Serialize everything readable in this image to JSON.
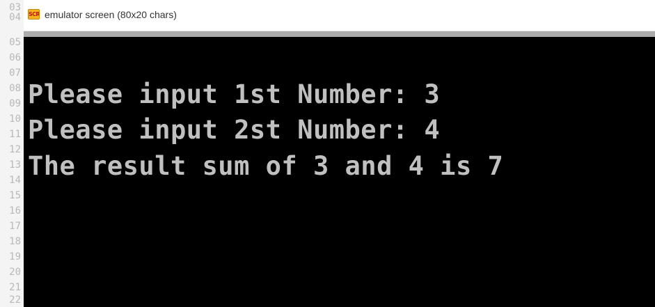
{
  "window": {
    "title": "emulator screen (80x20 chars)",
    "icon": {
      "name": "emu8086-app-icon",
      "label": "SCR"
    }
  },
  "gutter": {
    "line_numbers": [
      "03",
      "04",
      "05",
      "06",
      "07",
      "08",
      "09",
      "10",
      "11",
      "12",
      "13",
      "14",
      "15",
      "16",
      "17",
      "18",
      "19",
      "20",
      "21",
      "22"
    ]
  },
  "screen": {
    "size": "80x20 chars",
    "lines": [
      "Please input 1st Number: 3",
      "Please input 2st Number: 4",
      "The result sum of 3 and 4 is 7"
    ],
    "colors": {
      "background": "#000000",
      "text": "#c0c0c0"
    }
  }
}
